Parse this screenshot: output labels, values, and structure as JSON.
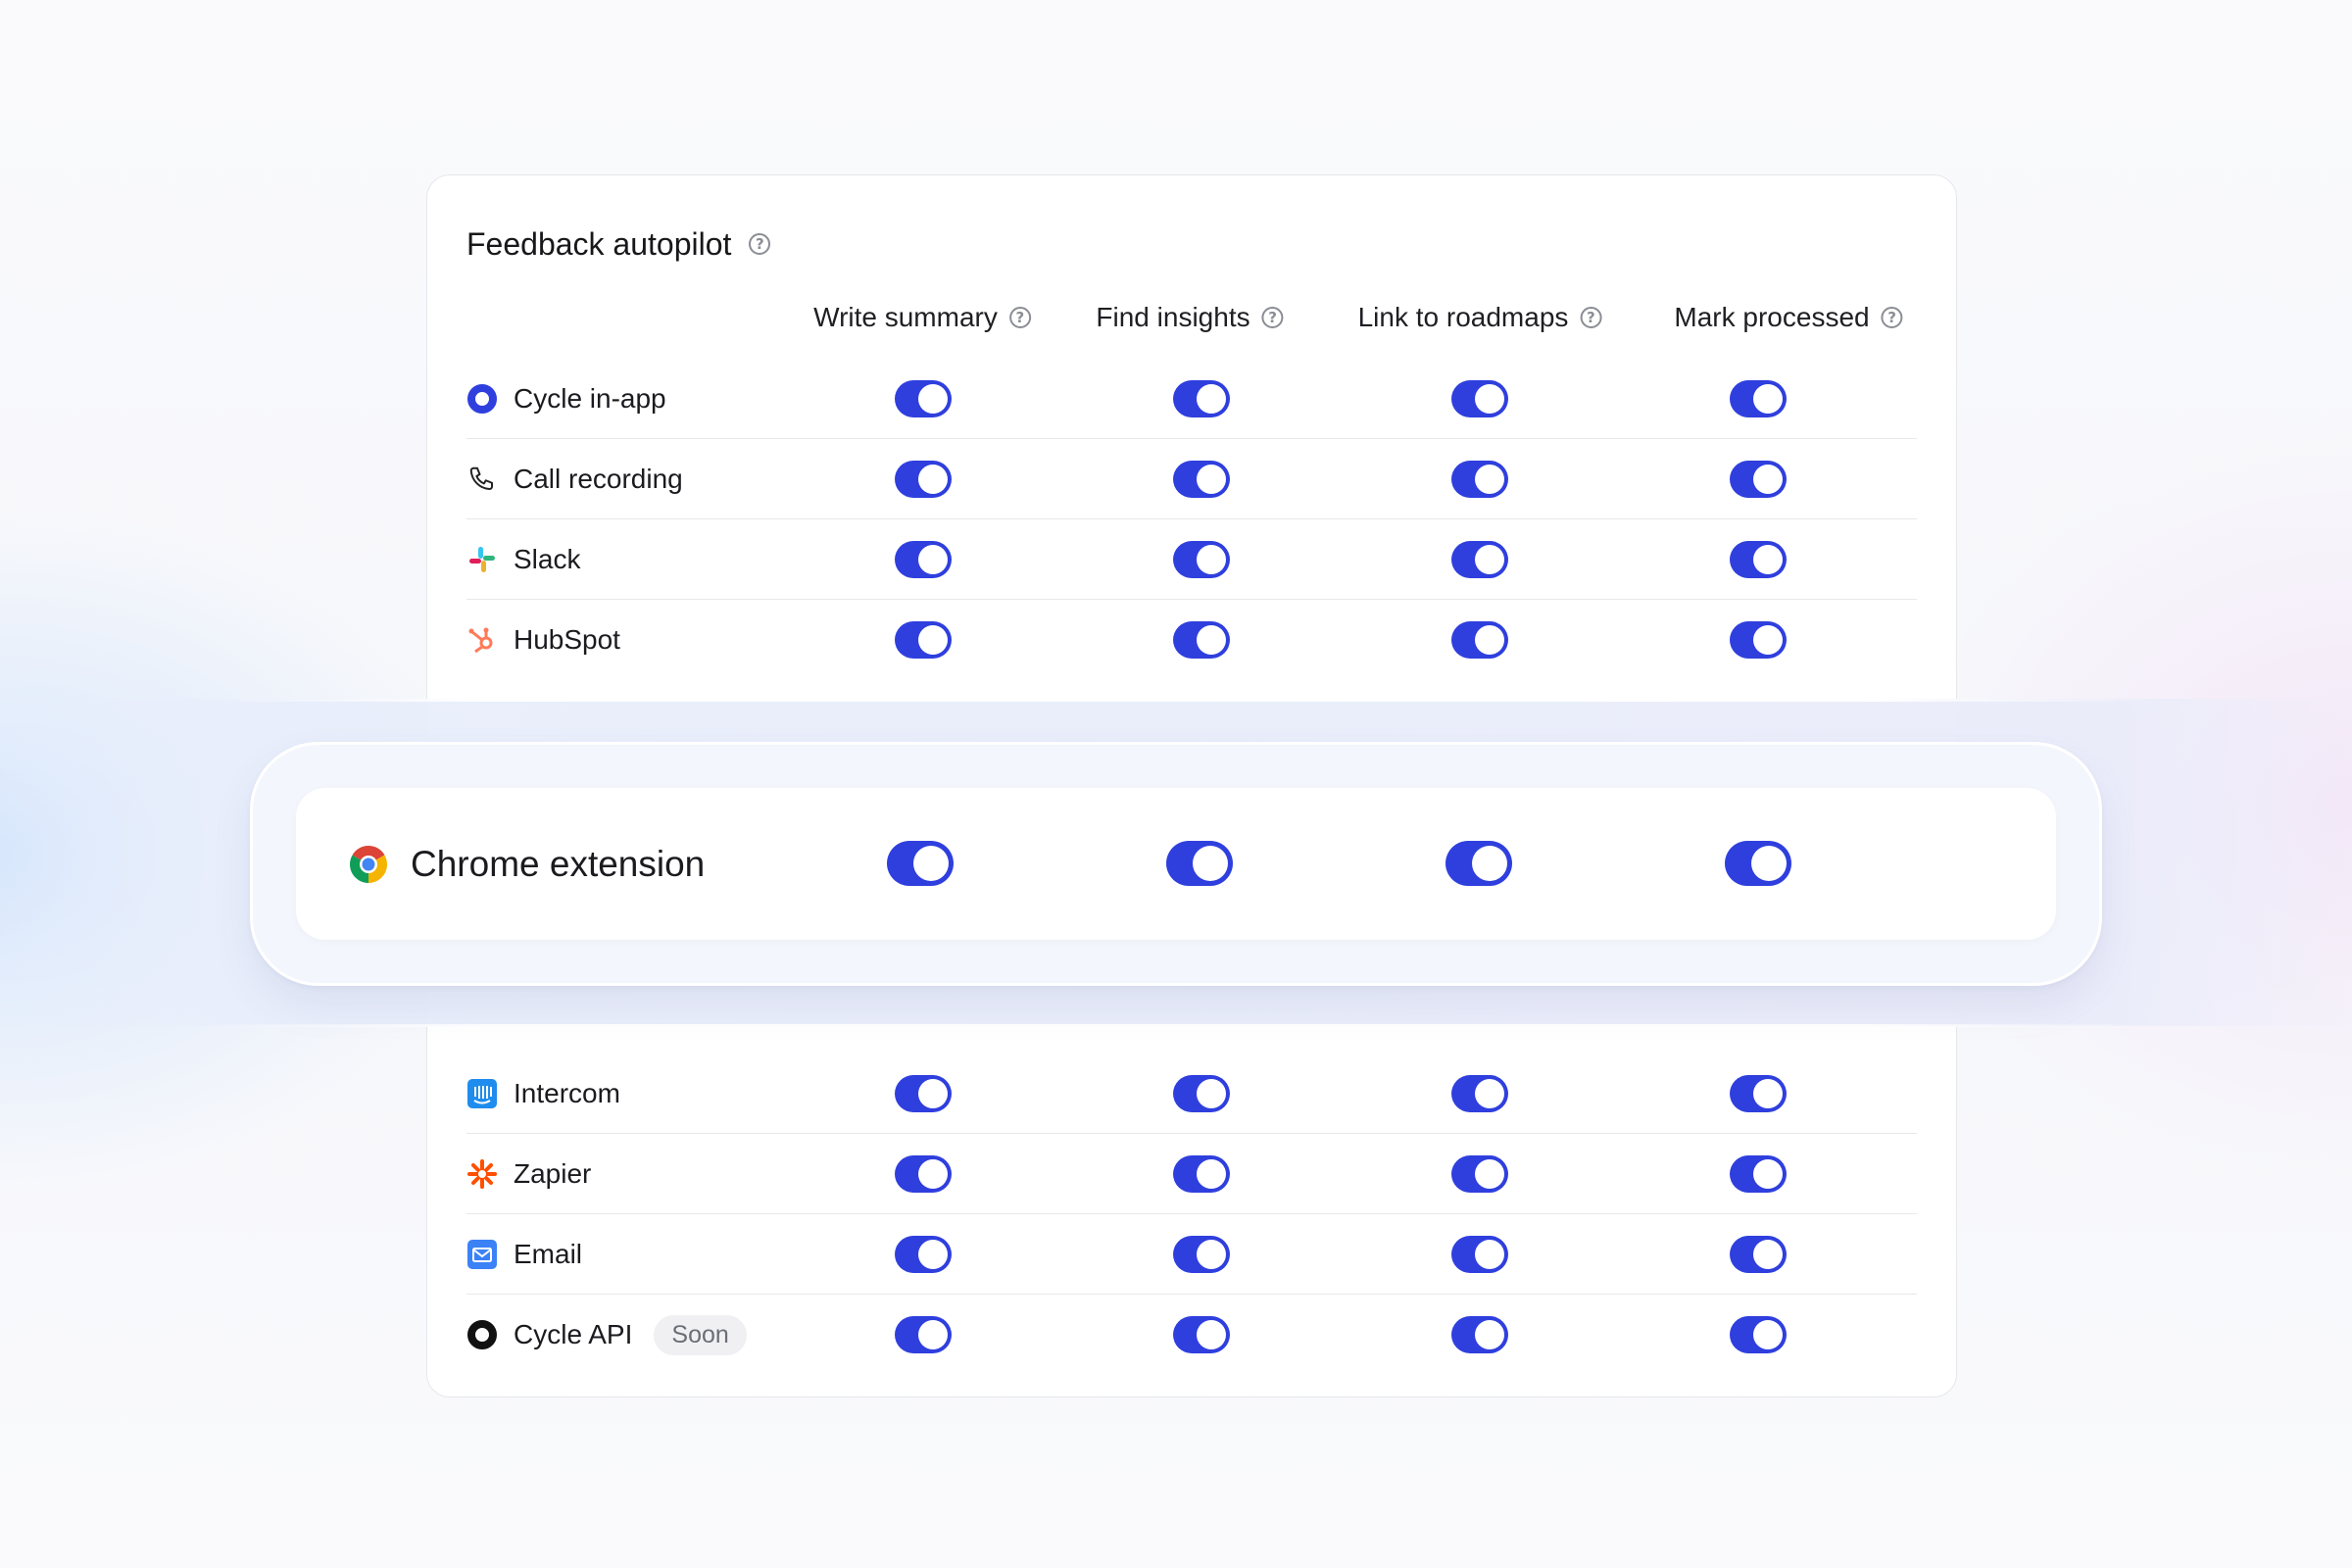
{
  "card": {
    "title": "Feedback autopilot",
    "title_icon": "help-circle-icon"
  },
  "columns": [
    {
      "label": "Write summary",
      "icon": "help-circle-icon"
    },
    {
      "label": "Find insights",
      "icon": "help-circle-icon"
    },
    {
      "label": "Link to roadmaps",
      "icon": "help-circle-icon"
    },
    {
      "label": "Mark processed",
      "icon": "help-circle-icon"
    }
  ],
  "rows_top": [
    {
      "label": "Cycle in-app",
      "icon": "cycle-logo-icon",
      "toggles": [
        true,
        true,
        true,
        true
      ]
    },
    {
      "label": "Call recording",
      "icon": "phone-icon",
      "toggles": [
        true,
        true,
        true,
        true
      ]
    },
    {
      "label": "Slack",
      "icon": "slack-icon",
      "toggles": [
        true,
        true,
        true,
        true
      ]
    },
    {
      "label": "HubSpot",
      "icon": "hubspot-icon",
      "toggles": [
        true,
        true,
        true,
        true
      ]
    }
  ],
  "highlight": {
    "label": "Chrome extension",
    "icon": "chrome-icon",
    "toggles": [
      true,
      true,
      true,
      true
    ]
  },
  "rows_bottom": [
    {
      "label": "Intercom",
      "icon": "intercom-icon",
      "toggles": [
        true,
        true,
        true,
        true
      ]
    },
    {
      "label": "Zapier",
      "icon": "zapier-icon",
      "toggles": [
        true,
        true,
        true,
        true
      ]
    },
    {
      "label": "Email",
      "icon": "email-icon",
      "toggles": [
        true,
        true,
        true,
        true
      ]
    },
    {
      "label": "Cycle API",
      "icon": "cycle-api-icon",
      "badge": "Soon",
      "toggles": [
        true,
        true,
        true,
        true
      ]
    }
  ],
  "colors": {
    "toggle_on": "#2f3fde",
    "cycle_blue": "#2f3fde",
    "hubspot": "#ff7a59",
    "zapier": "#ff4f00",
    "intercom": "#1f8ded",
    "email": "#3b82f6"
  }
}
